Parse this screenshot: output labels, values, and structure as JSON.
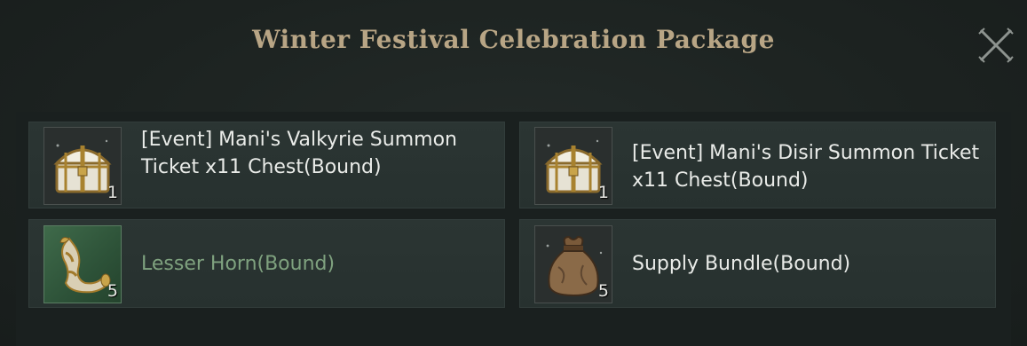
{
  "dialog": {
    "title": "Winter Festival Celebration Package"
  },
  "close_icon": "close-x-icon",
  "colors": {
    "title": "#b8a585",
    "text": "#e9ebe8",
    "uncommon_text": "#7fa27f",
    "card_bg": "#2b3533"
  },
  "items": [
    {
      "name": "[Event] Mani's Valkyrie Summon Ticket x11 Chest(Bound)",
      "quantity": "1",
      "icon": "chest-icon"
    },
    {
      "name": "[Event] Mani's Disir Summon Ticket x11 Chest(Bound)",
      "quantity": "1",
      "icon": "chest-icon"
    },
    {
      "name": "Lesser Horn(Bound)",
      "quantity": "5",
      "icon": "horn-icon"
    },
    {
      "name": "Supply Bundle(Bound)",
      "quantity": "5",
      "icon": "sack-icon"
    }
  ]
}
